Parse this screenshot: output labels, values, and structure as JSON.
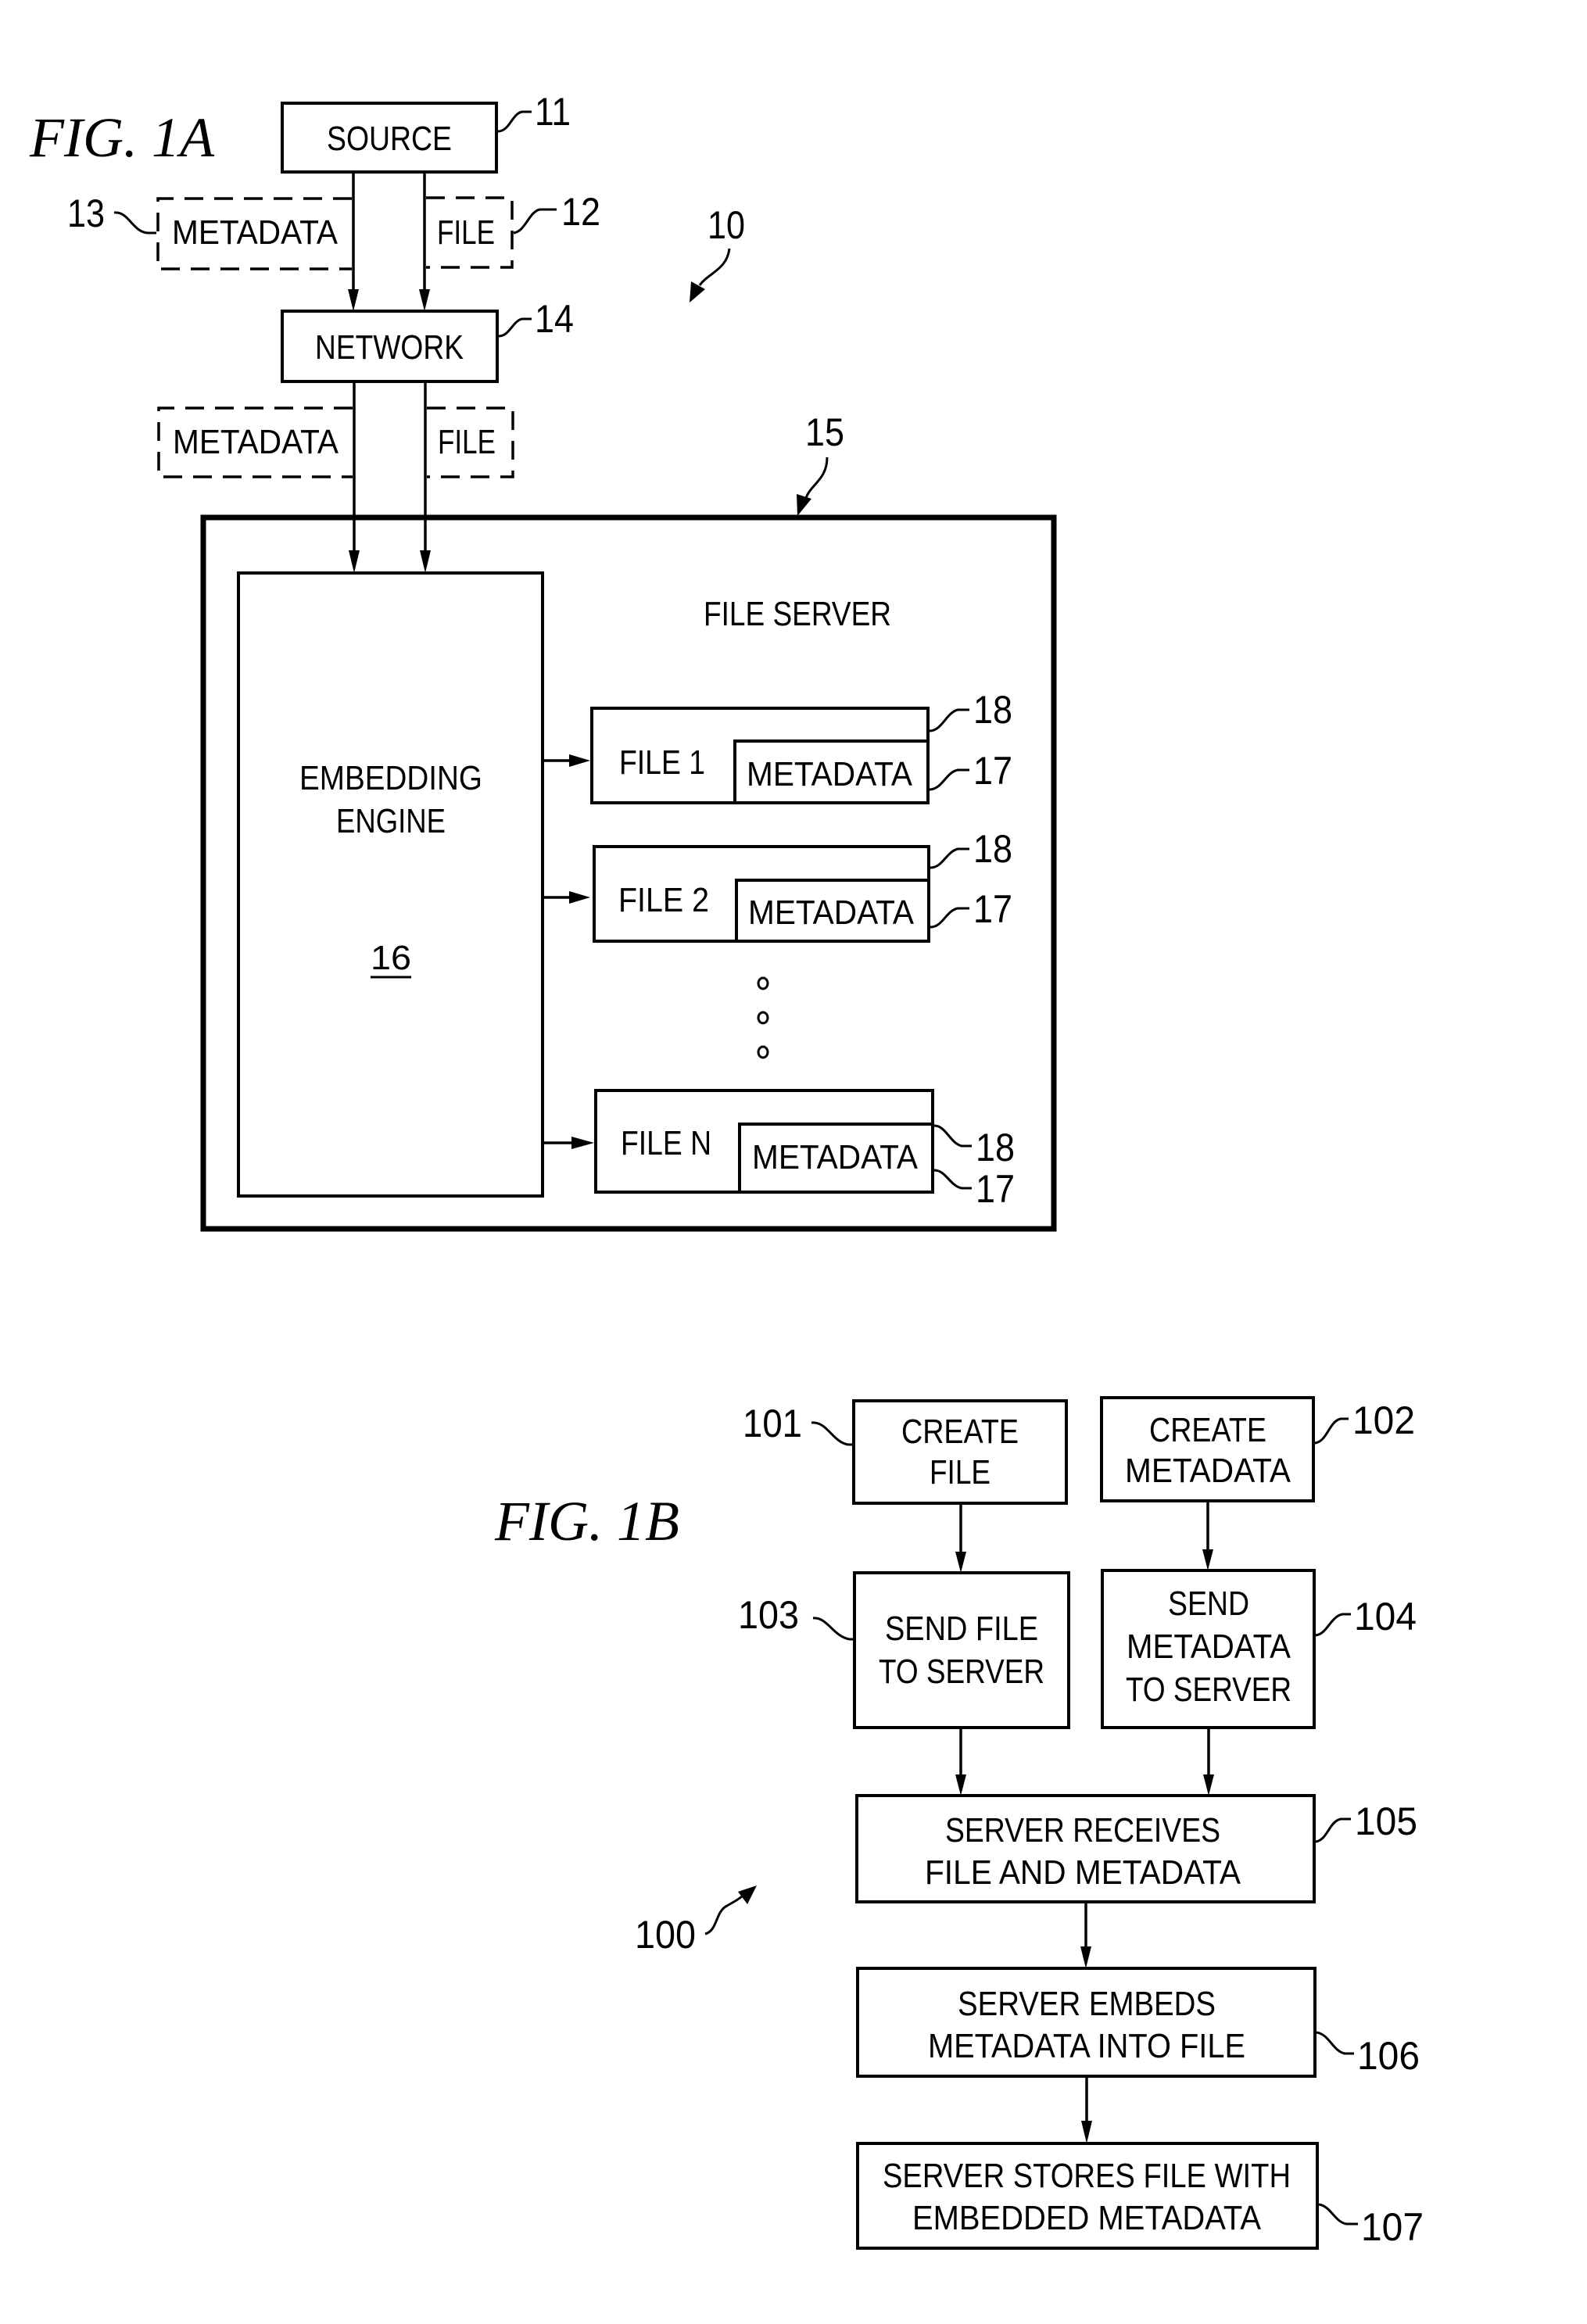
{
  "fig1a": {
    "title": "FIG. 1A",
    "system_ref": "10",
    "source": {
      "label": "SOURCE",
      "ref": "11"
    },
    "file_packet": {
      "label": "FILE",
      "ref": "12"
    },
    "metadata_packet": {
      "label": "METADATA",
      "ref": "13"
    },
    "network": {
      "label": "NETWORK",
      "ref": "14"
    },
    "packets_after_network": {
      "metadata_label": "METADATA",
      "file_label": "FILE"
    },
    "file_server": {
      "label": "FILE SERVER",
      "ref": "15"
    },
    "embedding_engine": {
      "line1": "EMBEDDING",
      "line2": "ENGINE",
      "ref": "16"
    },
    "stored_files": [
      {
        "label": "FILE 1",
        "metadata_label": "METADATA",
        "file_ref": "18",
        "metadata_ref": "17"
      },
      {
        "label": "FILE 2",
        "metadata_label": "METADATA",
        "file_ref": "18",
        "metadata_ref": "17"
      },
      {
        "label": "FILE N",
        "metadata_label": "METADATA",
        "file_ref": "18",
        "metadata_ref": "17"
      }
    ]
  },
  "fig1b": {
    "title": "FIG. 1B",
    "method_ref": "100",
    "steps": [
      {
        "ref": "101",
        "lines": [
          "CREATE",
          "FILE"
        ]
      },
      {
        "ref": "102",
        "lines": [
          "CREATE",
          "METADATA"
        ]
      },
      {
        "ref": "103",
        "lines": [
          "SEND FILE",
          "TO SERVER"
        ]
      },
      {
        "ref": "104",
        "lines": [
          "SEND",
          "METADATA",
          "TO SERVER"
        ]
      },
      {
        "ref": "105",
        "lines": [
          "SERVER RECEIVES",
          "FILE AND METADATA"
        ]
      },
      {
        "ref": "106",
        "lines": [
          "SERVER EMBEDS",
          "METADATA INTO FILE"
        ]
      },
      {
        "ref": "107",
        "lines": [
          "SERVER STORES FILE WITH",
          "EMBEDDED METADATA"
        ]
      }
    ]
  }
}
